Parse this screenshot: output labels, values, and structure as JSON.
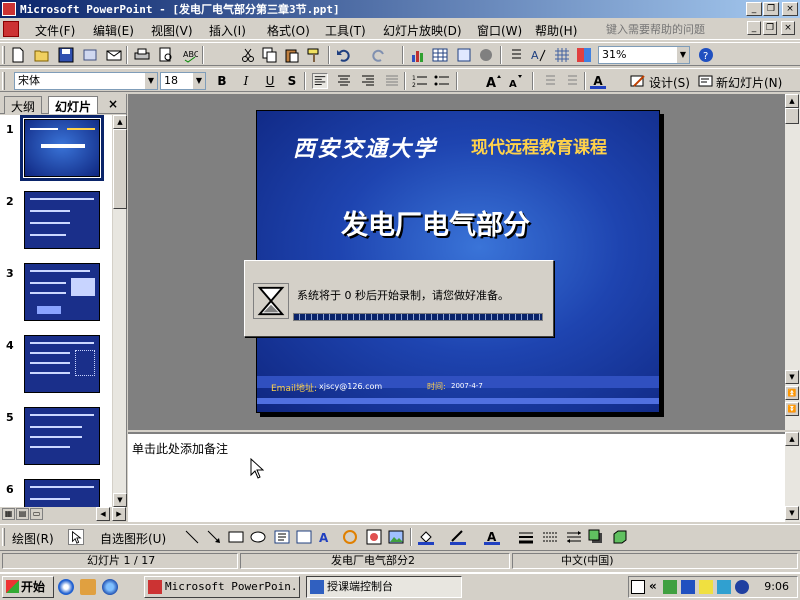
{
  "window": {
    "title": "Microsoft PowerPoint - [发电厂电气部分第三章3节.ppt]",
    "mdi_minimize": "_",
    "mdi_restore": "❐",
    "mdi_close": "×",
    "win_minimize": "_",
    "win_restore": "❐",
    "win_close": "×"
  },
  "menu": {
    "items": [
      "文件(F)",
      "编辑(E)",
      "视图(V)",
      "插入(I)",
      "格式(O)",
      "工具(T)",
      "幻灯片放映(D)",
      "窗口(W)",
      "帮助(H)"
    ],
    "help_placeholder": "键入需要帮助的问题"
  },
  "standard_toolbar": {
    "zoom": "31%"
  },
  "formatting_toolbar": {
    "font": "宋体",
    "size": "18",
    "bold": "B",
    "italic": "I",
    "underline": "U",
    "shadow": "S",
    "font_color_glyph": "A",
    "design_label": "设计(S)",
    "new_slide_label": "新幻灯片(N)"
  },
  "left_pane": {
    "tabs": [
      "大纲",
      "幻灯片"
    ],
    "active_tab": "幻灯片",
    "close": "×",
    "slide_numbers": [
      "1",
      "2",
      "3",
      "4",
      "5",
      "6"
    ],
    "selected_slide": "1"
  },
  "slide": {
    "logo_text": "西安交通大学",
    "subtitle": "现代远程教育课程",
    "title": "发电厂电气部分",
    "email_label": "Email地址:",
    "email_value": "xjscy@126.com",
    "date_label": "时间:",
    "date_value": "2007-4-7"
  },
  "dialog": {
    "message": "系统将于  0  秒后开始录制，请您做好准备。",
    "progress": 1.0
  },
  "notes": {
    "placeholder": "单击此处添加备注"
  },
  "drawing_toolbar": {
    "draw_label": "绘图(R)",
    "autoshapes_label": "自选图形(U)"
  },
  "status_bar": {
    "slide_pos": "幻灯片 1 / 17",
    "design": "发电厂电气部分2",
    "language": "中文(中国)"
  },
  "taskbar": {
    "start": "开始",
    "tasks": [
      "Microsoft PowerPoin...",
      "授课端控制台"
    ],
    "active_task": "授课端控制台",
    "clock": "9:06",
    "tray_chevron": "«"
  },
  "colors": {
    "title_bar": "#0a246a",
    "slide_bg": "#1e44b0",
    "slide_subtitle": "#ffd24a"
  }
}
